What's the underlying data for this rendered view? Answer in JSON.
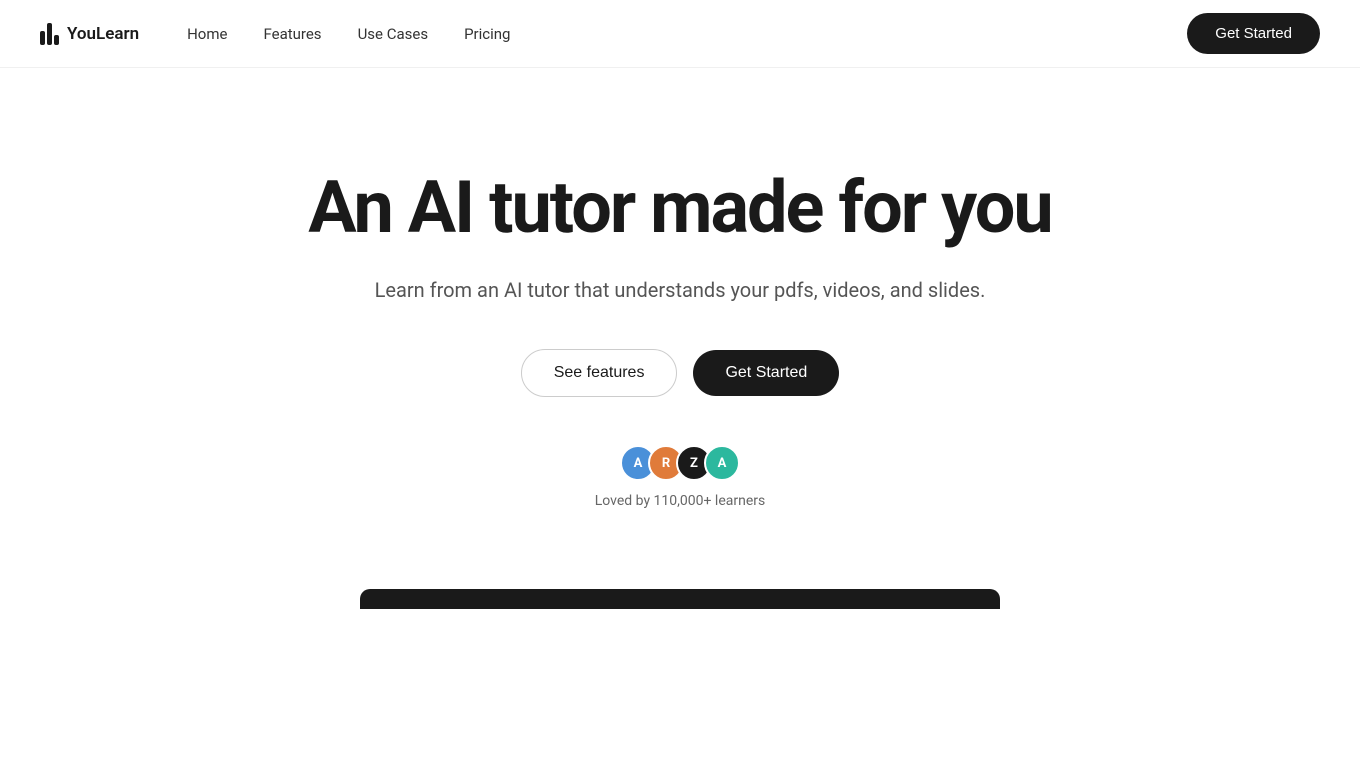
{
  "logo": {
    "text": "YouLearn"
  },
  "nav": {
    "links": [
      {
        "label": "Home",
        "href": "#"
      },
      {
        "label": "Features",
        "href": "#"
      },
      {
        "label": "Use Cases",
        "href": "#"
      },
      {
        "label": "Pricing",
        "href": "#"
      }
    ],
    "cta_label": "Get Started"
  },
  "hero": {
    "title": "An AI tutor made for you",
    "subtitle": "Learn from an AI tutor that understands your pdfs, videos, and slides.",
    "btn_see_features": "See features",
    "btn_get_started": "Get Started"
  },
  "social_proof": {
    "avatars": [
      {
        "letter": "A",
        "color_class": "avatar-a1"
      },
      {
        "letter": "R",
        "color_class": "avatar-r"
      },
      {
        "letter": "Z",
        "color_class": "avatar-z"
      },
      {
        "letter": "A",
        "color_class": "avatar-a2"
      }
    ],
    "text": "Loved by 110,000+ learners"
  }
}
